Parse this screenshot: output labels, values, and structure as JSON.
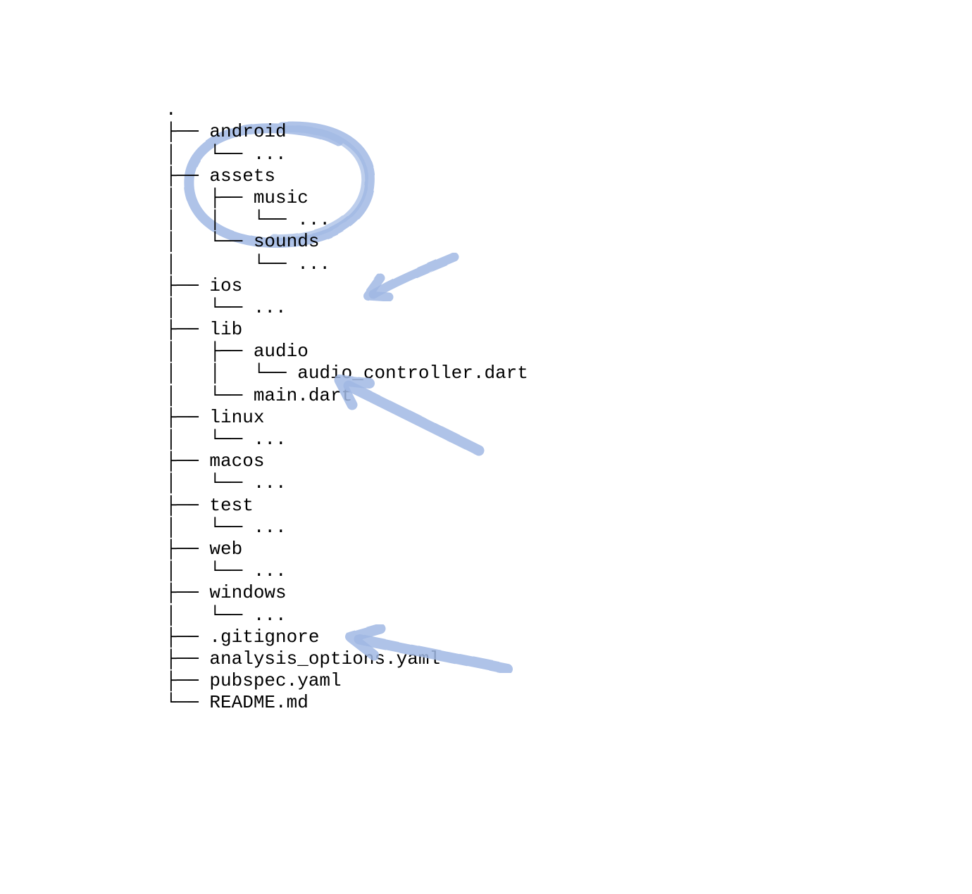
{
  "annotation_color": "#a1b9e4",
  "tree": {
    "root": ".",
    "lines": [
      ".",
      "├── android",
      "│   └── ...",
      "├── assets",
      "│   ├── music",
      "│   │   └── ...",
      "│   └── sounds",
      "│       └── ...",
      "├── ios",
      "│   └── ...",
      "├── lib",
      "│   ├── audio",
      "│   │   └── audio_controller.dart",
      "│   └── main.dart",
      "├── linux",
      "│   └── ...",
      "├── macos",
      "│   └── ...",
      "├── test",
      "│   └── ...",
      "├── web",
      "│   └── ...",
      "├── windows",
      "│   └── ...",
      "├── .gitignore",
      "├── analysis_options.yaml",
      "├── pubspec.yaml",
      "└── README.md"
    ]
  },
  "annotations": [
    {
      "kind": "circle",
      "target": "assets",
      "note": "hand-drawn circle around assets subtree"
    },
    {
      "kind": "arrow",
      "target": "lib/audio",
      "note": "arrow pointing from upper right toward lib/audio area"
    },
    {
      "kind": "arrow",
      "target": "main.dart",
      "note": "arrow from lower right pointing toward main.dart / linux area"
    },
    {
      "kind": "arrow",
      "target": "pubspec.yaml",
      "note": "arrow from lower right pointing toward pubspec.yaml"
    }
  ]
}
